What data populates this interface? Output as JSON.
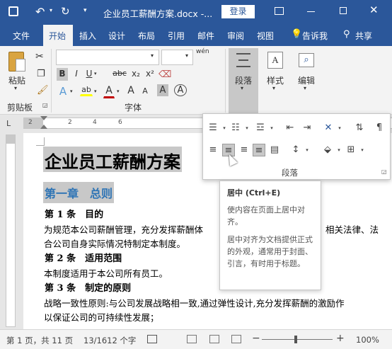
{
  "titlebar": {
    "doc_title": "企业员工薪酬方案.docx -...",
    "login_label": "登录"
  },
  "tabs": [
    {
      "label": "文件"
    },
    {
      "label": "开始"
    },
    {
      "label": "插入"
    },
    {
      "label": "设计"
    },
    {
      "label": "布局"
    },
    {
      "label": "引用"
    },
    {
      "label": "邮件"
    },
    {
      "label": "审阅"
    },
    {
      "label": "视图"
    }
  ],
  "tellme": "告诉我",
  "share": "共享",
  "ribbon": {
    "paste": "粘贴",
    "clipboard_group": "剪贴板",
    "font_group": "字体",
    "paragraph": "段落",
    "styles": "样式",
    "editing": "编辑",
    "font_btns": {
      "bold": "B",
      "italic": "I",
      "underline": "U",
      "strike": "abc",
      "sub": "x₂",
      "sup": "x²",
      "text_effect": "A",
      "highlight": "ab",
      "font_color": "A",
      "grow": "A",
      "shrink": "A",
      "char_shade": "A",
      "wen": "wén",
      "char_border": "A"
    }
  },
  "popup": {
    "group_label": "段落"
  },
  "tooltip": {
    "title": "居中 (Ctrl+E)",
    "line1": "使内容在页面上居中对齐。",
    "line2": "居中对齐为文档提供正式的外观，通常用于封面、引言，有时用于标题。"
  },
  "ruler": {
    "nums": [
      "2",
      "2",
      "4",
      "6"
    ],
    "corner": "L"
  },
  "document": {
    "title": "企业员工薪酬方案",
    "chapter": "第一章　总则",
    "art1": "第 1 条　目的",
    "art1_body1": "为规范本公司薪酬管理，充分发挥薪酬体",
    "art1_body1b": "相关法律、法",
    "art1_body2": "合公司自身实际情况特制定本制度。",
    "art2": "第 2 条　适用范围",
    "art2_body": "本制度适用于本公司所有员工。",
    "art3": "第 3 条　制定的原则",
    "art3_body1": "战略一致性原则:与公司发展战略相一致,通过弹性设计,充分发挥薪酬的激励作",
    "art3_body2": "以保证公司的可持续性发展；"
  },
  "status": {
    "page": "第 1 页，共 11 页",
    "words": "13/1612 个字",
    "zoom": "100%",
    "zoom_minus": "−",
    "zoom_plus": "+"
  }
}
